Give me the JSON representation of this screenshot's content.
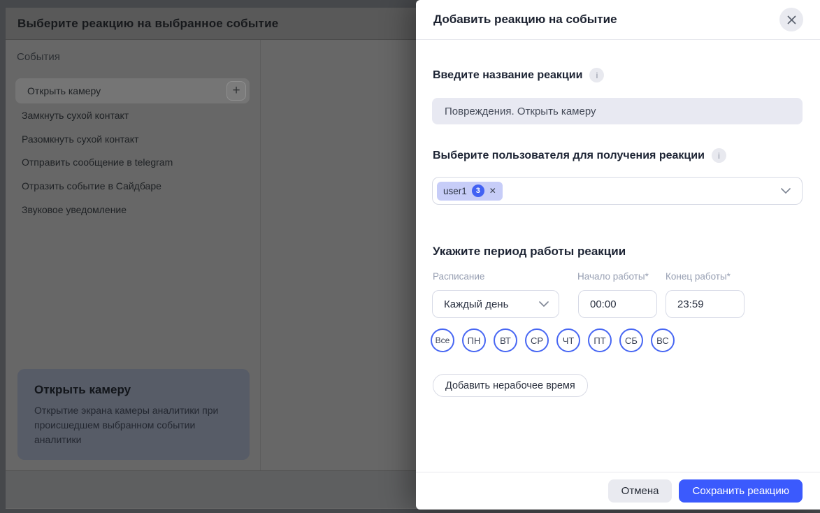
{
  "background_page": {
    "title": "Выберите реакцию на выбранное событие",
    "events_section_title": "События",
    "events": [
      {
        "label": "Открыть камеру",
        "selected": true
      },
      {
        "label": "Замкнуть сухой контакт"
      },
      {
        "label": "Разомкнуть сухой контакт"
      },
      {
        "label": "Отправить сообщение в telegram"
      },
      {
        "label": "Отразить событие в Сайдбаре"
      },
      {
        "label": "Звуковое уведомление"
      }
    ],
    "detail_card": {
      "title": "Открыть камеру",
      "description": "Открытие экрана камеры аналитики при происшедшем выбранном событии аналитики"
    }
  },
  "modal": {
    "title": "Добавить реакцию на событие",
    "name_field": {
      "label": "Введите название реакции",
      "value": "Повреждения. Открыть камеру"
    },
    "user_field": {
      "label": "Выберите пользователя для получения реакции",
      "chip": {
        "label": "user1",
        "count": "3"
      }
    },
    "period_section": {
      "title": "Укажите период работы реакции",
      "schedule": {
        "label": "Расписание",
        "value": "Каждый день"
      },
      "start": {
        "label": "Начало работы",
        "required_mark": "*",
        "value": "00:00"
      },
      "end": {
        "label": "Конец работы",
        "required_mark": "*",
        "value": "23:59"
      },
      "days": [
        "Все",
        "ПН",
        "ВТ",
        "СР",
        "ЧТ",
        "ПТ",
        "СБ",
        "ВС"
      ],
      "add_downtime_label": "Добавить нерабочее время"
    },
    "footer": {
      "cancel_label": "Отмена",
      "save_label": "Сохранить реакцию"
    }
  },
  "icons": {
    "add": "+",
    "info": "i",
    "chip_remove": "✕"
  },
  "colors": {
    "accent_blue": "#3b5afd",
    "badge_blue": "#4161f3",
    "day_border_blue": "#4867f3",
    "chip_bg": "#c7cdf8",
    "name_input_bg": "#e8e9f2",
    "muted_button_bg": "#e9eaf0",
    "backdrop": "#46484b"
  }
}
